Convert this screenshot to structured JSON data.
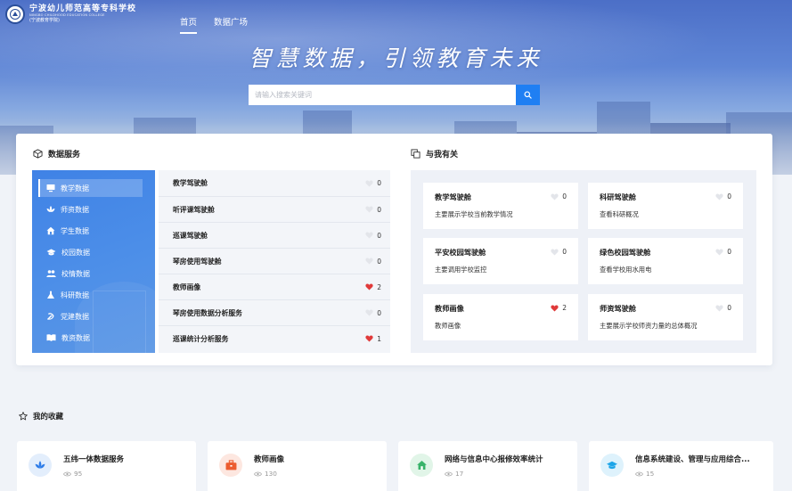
{
  "logo": {
    "cn": "宁波幼儿师范高等专科学校",
    "en": "NINGBO CHILDHOOD EDUCATION COLLEGE",
    "sub": "(宁波教育学院)"
  },
  "nav": [
    {
      "label": "首页",
      "active": true
    },
    {
      "label": "数据广场",
      "active": false
    }
  ],
  "hero": {
    "slogan": "智慧数据，引领教育未来",
    "search_placeholder": "请输入搜索关键词"
  },
  "data_services": {
    "title": "数据服务",
    "categories": [
      {
        "label": "教学数据",
        "icon": "monitor-icon",
        "active": true
      },
      {
        "label": "师资数据",
        "icon": "lotus-icon",
        "active": false
      },
      {
        "label": "学生数据",
        "icon": "house-icon",
        "active": false
      },
      {
        "label": "校园数据",
        "icon": "graduation-cap-icon",
        "active": false
      },
      {
        "label": "校情数据",
        "icon": "users-icon",
        "active": false
      },
      {
        "label": "科研数据",
        "icon": "flask-icon",
        "active": false
      },
      {
        "label": "党建数据",
        "icon": "party-emblem-icon",
        "active": false
      },
      {
        "label": "教资数据",
        "icon": "book-icon",
        "active": false
      }
    ],
    "services": [
      {
        "name": "教学驾驶舱",
        "likes": "0",
        "liked": false
      },
      {
        "name": "听评课驾驶舱",
        "likes": "0",
        "liked": false
      },
      {
        "name": "巡课驾驶舱",
        "likes": "0",
        "liked": false
      },
      {
        "name": "琴房使用驾驶舱",
        "likes": "0",
        "liked": false
      },
      {
        "name": "教师画像",
        "likes": "2",
        "liked": true
      },
      {
        "name": "琴房使用数据分析服务",
        "likes": "0",
        "liked": false
      },
      {
        "name": "巡课统计分析服务",
        "likes": "1",
        "liked": true
      }
    ]
  },
  "related": {
    "title": "与我有关",
    "cards": [
      {
        "title": "教学驾驶舱",
        "desc": "主要展示学校当前教学情况",
        "likes": "0",
        "liked": false
      },
      {
        "title": "科研驾驶舱",
        "desc": "查看科研概况",
        "likes": "0",
        "liked": false
      },
      {
        "title": "平安校园驾驶舱",
        "desc": "主要调用学校监控",
        "likes": "0",
        "liked": false
      },
      {
        "title": "绿色校园驾驶舱",
        "desc": "查看学校用水用电",
        "likes": "0",
        "liked": false
      },
      {
        "title": "教师画像",
        "desc": "教师画像",
        "likes": "2",
        "liked": true
      },
      {
        "title": "师资驾驶舱",
        "desc": "主要展示学校师资力量的总体概况",
        "likes": "0",
        "liked": false
      }
    ]
  },
  "favorites": {
    "title": "我的收藏",
    "items": [
      {
        "name": "五纬一体数据服务",
        "views": "95",
        "icon": "lotus-icon",
        "color": "#2f7de8",
        "bg": "#e3eefc"
      },
      {
        "name": "教师画像",
        "views": "130",
        "icon": "briefcase-icon",
        "color": "#ec5c2f",
        "bg": "#fde7e0"
      },
      {
        "name": "网络与信息中心报修效率统计",
        "views": "17",
        "icon": "house-icon",
        "color": "#39b36a",
        "bg": "#e1f5e8"
      },
      {
        "name": "信息系统建设、管理与应用综合...",
        "views": "15",
        "icon": "graduation-cap-icon",
        "color": "#1ea5e8",
        "bg": "#def2fc"
      }
    ]
  },
  "colors": {
    "accent": "#1f7ff3",
    "liked": "#e03a3a",
    "unliked": "#e3e5ea"
  }
}
